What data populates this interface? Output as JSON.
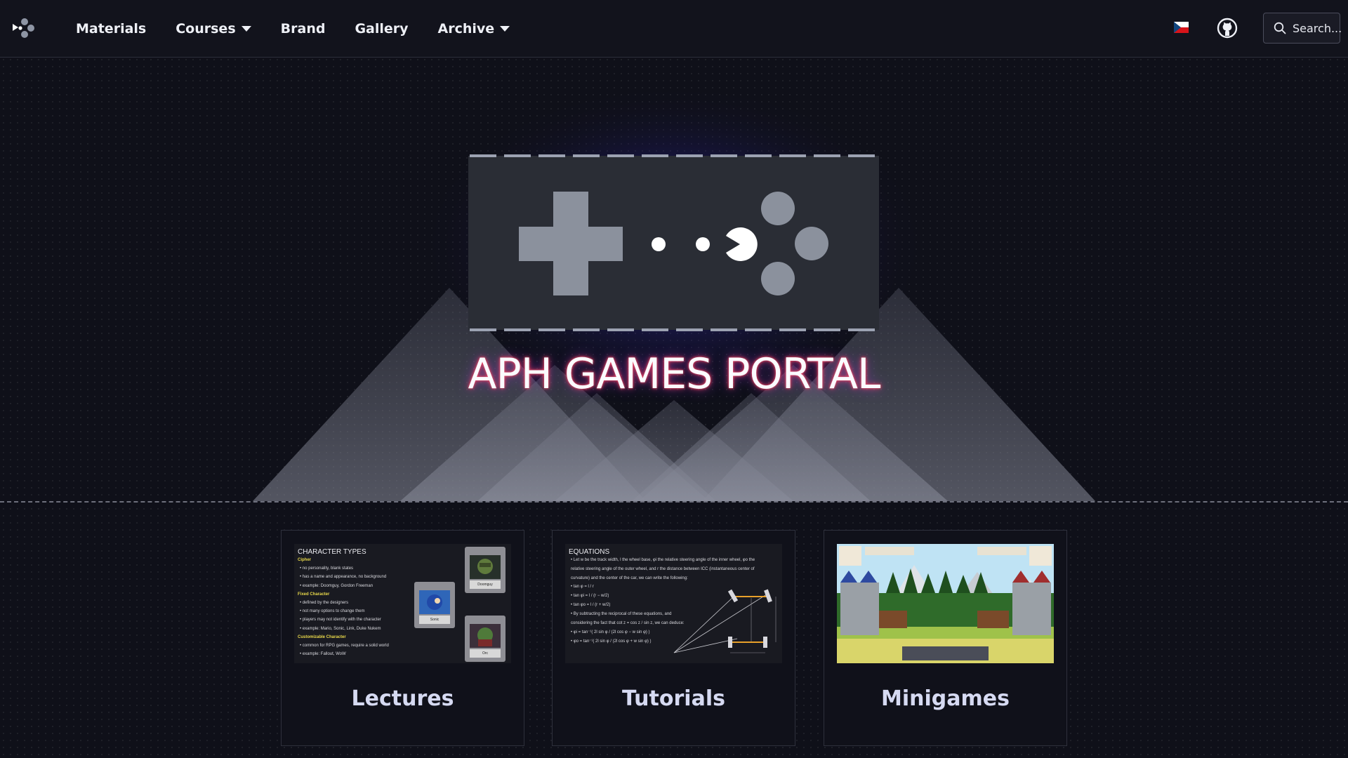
{
  "nav": {
    "links": [
      {
        "label": "Materials",
        "dropdown": false
      },
      {
        "label": "Courses",
        "dropdown": true
      },
      {
        "label": "Brand",
        "dropdown": false
      },
      {
        "label": "Gallery",
        "dropdown": false
      },
      {
        "label": "Archive",
        "dropdown": true
      }
    ],
    "language_icon": "czech-flag-icon",
    "github_icon": "github-icon",
    "search_label": "Search..."
  },
  "hero": {
    "title": "APH GAMES PORTAL",
    "logo_icon": "gamepad-logo-icon"
  },
  "colors": {
    "background": "#0f1019",
    "panel": "#2a2d35",
    "accent_glow": "#3a2bd6",
    "title_glow": "#ff4f6a"
  },
  "cards": [
    {
      "label": "Lectures",
      "thumb": {
        "title": "CHARACTER TYPES",
        "lines": [
          {
            "t": "Cipher",
            "h": true
          },
          {
            "t": "• no personality, blank states",
            "h": false
          },
          {
            "t": "• has a name and appearance, no background",
            "h": false
          },
          {
            "t": "• example: Doomguy, Gordon Freeman",
            "h": false
          },
          {
            "t": "Fixed Character",
            "h": true
          },
          {
            "t": "• defined by the designers",
            "h": false
          },
          {
            "t": "• not many options to change them",
            "h": false
          },
          {
            "t": "• players may not identify with the character",
            "h": false
          },
          {
            "t": "• example: Mario, Sonic, Link, Duke Nukem",
            "h": false
          },
          {
            "t": "Customizable Character",
            "h": true
          },
          {
            "t": "• common for RPG games, require a solid world",
            "h": false
          },
          {
            "t": "• example: Fallout, WoW",
            "h": false
          }
        ],
        "cartridges": [
          "Doomguy",
          "Sonic",
          "Orc"
        ]
      }
    },
    {
      "label": "Tutorials",
      "thumb": {
        "title": "EQUATIONS",
        "lines": [
          {
            "t": "• Let w be the track width, l the wheel base, φi the relative steering angle of the inner wheel, φo the",
            "h": false
          },
          {
            "t": "relative steering angle of the outer wheel, and r the distance between ICC (instantaneous center of",
            "h": false
          },
          {
            "t": "curvature) and the center of the car, we can write the following:",
            "h": false
          },
          {
            "t": "• tan φ = l / r",
            "h": false
          },
          {
            "t": "• tan φi = l / (r − w/2)",
            "h": false
          },
          {
            "t": "• tan φo = l / (r + w/2)",
            "h": false
          },
          {
            "t": "• By subtracting the reciprocal of these equations, and",
            "h": false
          },
          {
            "t": "considering the fact that cot z = cos z / sin z, we can deduce:",
            "h": false
          },
          {
            "t": "• φi = tan⁻¹( 2l sin φ / (2l cos φ − w sin φ) )",
            "h": false
          },
          {
            "t": "• φo = tan⁻¹( 2l sin φ / (2l cos φ + w sin φ) )",
            "h": false
          }
        ]
      }
    },
    {
      "label": "Minigames",
      "thumb": {}
    }
  ]
}
